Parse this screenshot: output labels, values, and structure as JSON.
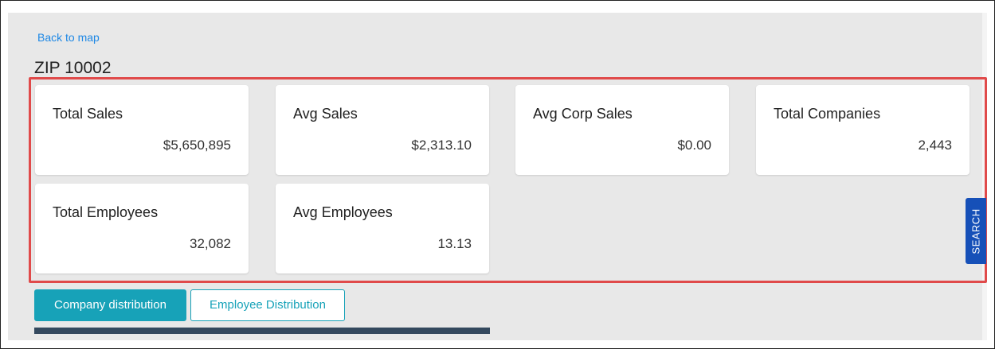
{
  "back_link": "Back to map",
  "title": "ZIP 10002",
  "stats": [
    {
      "label": "Total Sales",
      "value": "$5,650,895"
    },
    {
      "label": "Avg Sales",
      "value": "$2,313.10"
    },
    {
      "label": "Avg Corp Sales",
      "value": "$0.00"
    },
    {
      "label": "Total Companies",
      "value": "2,443"
    },
    {
      "label": "Total Employees",
      "value": "32,082"
    },
    {
      "label": "Avg Employees",
      "value": "13.13"
    }
  ],
  "search_tab": "SEARCH",
  "tabs": [
    {
      "label": "Company distribution",
      "active": true
    },
    {
      "label": "Employee Distribution",
      "active": false
    }
  ],
  "colors": {
    "link": "#1e88e5",
    "highlight_border": "#e04a4a",
    "primary": "#17a2b8",
    "search_tab": "#1650b8",
    "chart_strip": "#34495e"
  }
}
